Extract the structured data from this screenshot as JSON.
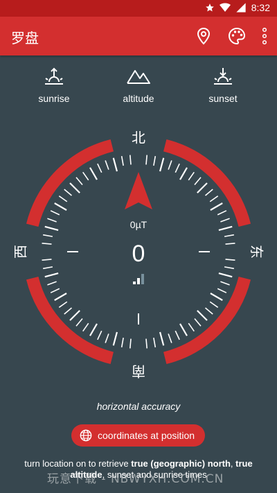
{
  "status_bar": {
    "time": "8:32"
  },
  "app_bar": {
    "title": "罗盘"
  },
  "top_actions": [
    {
      "label": "sunrise",
      "icon": "sunrise-icon"
    },
    {
      "label": "altitude",
      "icon": "mountain-icon"
    },
    {
      "label": "sunset",
      "icon": "sunset-icon"
    }
  ],
  "compass": {
    "north": "北",
    "east": "东",
    "south": "南",
    "west": "西",
    "field_strength": "0µT",
    "heading": "0",
    "accent_color": "#d32f2f"
  },
  "accuracy_label": "horizontal accuracy",
  "coords_button": {
    "label": "coordinates at position",
    "icon": "globe-icon"
  },
  "info": {
    "part1": "turn location on to retrieve ",
    "bold1": "true (geographic) north",
    "part2": ", ",
    "bold2": "true altitude",
    "part3": ", sunset and sunrise times"
  },
  "watermark": "玩意下载 - NBWYXH.COM.CN"
}
